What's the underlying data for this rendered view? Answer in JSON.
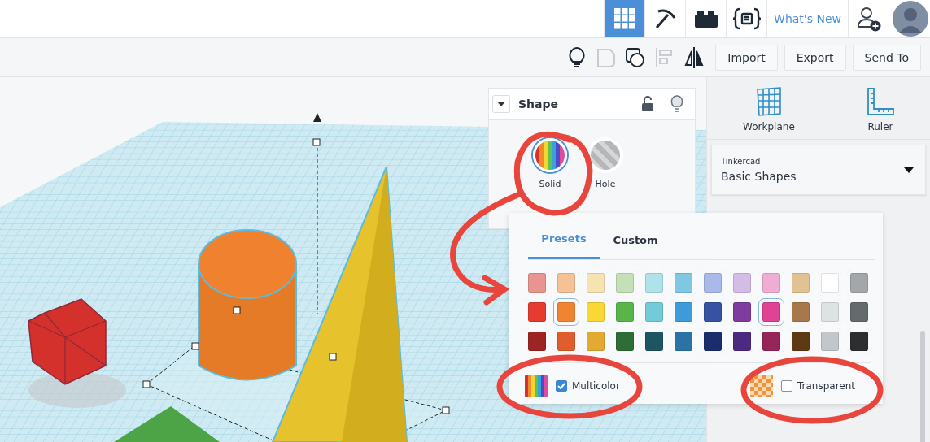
{
  "top_bar": {
    "nav_buttons": [
      {
        "selected": true
      },
      {
        "selected": false
      },
      {
        "selected": false
      },
      {
        "selected": false
      }
    ],
    "whats_new": "What's New"
  },
  "toolbar": {
    "tools": [
      {
        "disabled": false
      },
      {
        "disabled": true
      },
      {
        "disabled": false
      },
      {
        "disabled": true
      },
      {
        "disabled": false
      }
    ],
    "buttons": [
      "Import",
      "Export",
      "Send To"
    ]
  },
  "shape_panel": {
    "title": "Shape",
    "modes": [
      {
        "label": "Solid",
        "selected": true
      },
      {
        "label": "Hole",
        "selected": false
      }
    ]
  },
  "color_popup": {
    "tabs": [
      {
        "label": "Presets",
        "selected": true
      },
      {
        "label": "Custom",
        "selected": false
      }
    ],
    "swatches": [
      {
        "color": "#e8958f",
        "selected": false
      },
      {
        "color": "#f5c298",
        "selected": false
      },
      {
        "color": "#f5e3b0",
        "selected": false
      },
      {
        "color": "#c5e0b8",
        "selected": false
      },
      {
        "color": "#aee3ea",
        "selected": false
      },
      {
        "color": "#7ec8e4",
        "selected": false
      },
      {
        "color": "#a9b9ea",
        "selected": false
      },
      {
        "color": "#d3bde6",
        "selected": false
      },
      {
        "color": "#efadd4",
        "selected": false
      },
      {
        "color": "#e0c293",
        "selected": false
      },
      {
        "color": "#ffffff",
        "selected": false
      },
      {
        "color": "#a4a7a9",
        "selected": false
      },
      {
        "color": "#e53b30",
        "selected": false
      },
      {
        "color": "#ef8530",
        "selected": true
      },
      {
        "color": "#f8d834",
        "selected": false
      },
      {
        "color": "#59b548",
        "selected": false
      },
      {
        "color": "#72cbd8",
        "selected": false
      },
      {
        "color": "#3c9bd8",
        "selected": false
      },
      {
        "color": "#3652a0",
        "selected": false
      },
      {
        "color": "#7e3c9e",
        "selected": false
      },
      {
        "color": "#df4494",
        "selected": true
      },
      {
        "color": "#a6784c",
        "selected": false
      },
      {
        "color": "#dde2e3",
        "selected": false
      },
      {
        "color": "#656a6c",
        "selected": false
      },
      {
        "color": "#9b2523",
        "selected": false
      },
      {
        "color": "#e05e2b",
        "selected": false
      },
      {
        "color": "#e3aa31",
        "selected": false
      },
      {
        "color": "#2e6d35",
        "selected": false
      },
      {
        "color": "#1e5562",
        "selected": false
      },
      {
        "color": "#2b73a7",
        "selected": false
      },
      {
        "color": "#1a2e6b",
        "selected": false
      },
      {
        "color": "#4d2a80",
        "selected": false
      },
      {
        "color": "#962657",
        "selected": false
      },
      {
        "color": "#5e3a14",
        "selected": false
      },
      {
        "color": "#c1c7ca",
        "selected": false
      },
      {
        "color": "#2c2e30",
        "selected": false
      }
    ],
    "multicolor": {
      "label": "Multicolor",
      "checked": true
    },
    "transparent": {
      "label": "Transparent",
      "checked": false
    }
  },
  "right_panel": {
    "tools": [
      {
        "label": "Workplane"
      },
      {
        "label": "Ruler"
      }
    ],
    "library": {
      "caption": "Tinkercad",
      "value": "Basic Shapes"
    }
  }
}
